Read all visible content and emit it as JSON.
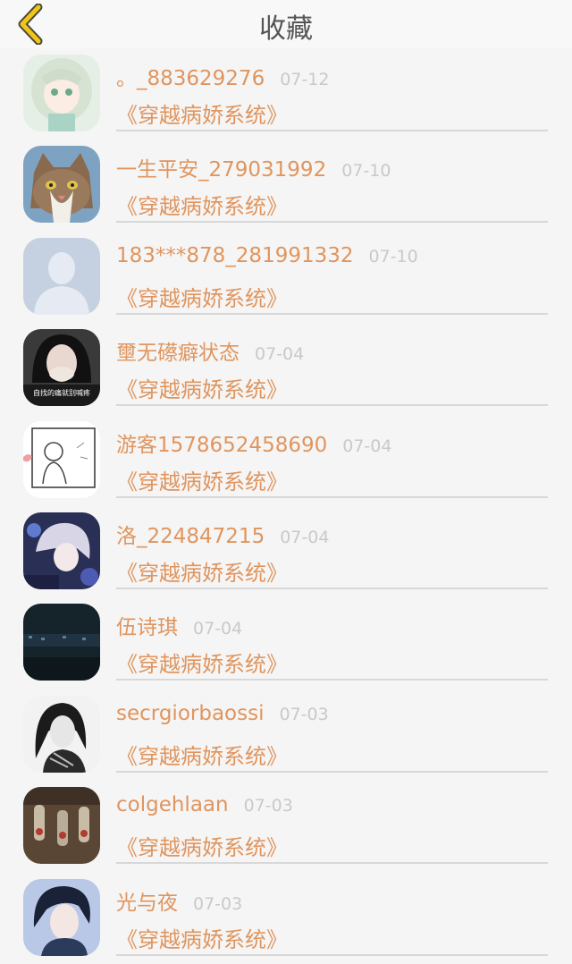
{
  "header": {
    "title": "收藏",
    "back_icon": "chevron-left-icon",
    "accent_color": "#f0c419"
  },
  "items": [
    {
      "user": "。_883629276",
      "date": "07-12",
      "book": "《穿越病娇系统》",
      "avatar": "anime-girl-avatar"
    },
    {
      "user": "一生平安_279031992",
      "date": "07-10",
      "book": "《穿越病娇系统》",
      "avatar": "cat-avatar"
    },
    {
      "user": "183***878_281991332",
      "date": "07-10",
      "book": "《穿越病娇系统》",
      "avatar": "default-person-avatar"
    },
    {
      "user": "壐无礤癖状态",
      "date": "07-04",
      "book": "《穿越病娇系统》",
      "avatar": "girl-photo-avatar"
    },
    {
      "user": "游客1578652458690",
      "date": "07-04",
      "book": "《穿越病娇系统》",
      "avatar": "sketch-avatar"
    },
    {
      "user": "洛_224847215",
      "date": "07-04",
      "book": "《穿越病娇系统》",
      "avatar": "anime-boy-avatar"
    },
    {
      "user": "伍诗琪",
      "date": "07-04",
      "book": "《穿越病娇系统》",
      "avatar": "night-city-avatar"
    },
    {
      "user": "secrgiorbaossi",
      "date": "07-03",
      "book": "《穿越病娇系统》",
      "avatar": "bw-girl-avatar"
    },
    {
      "user": "colgehlaan",
      "date": "07-03",
      "book": "《穿越病娇系统》",
      "avatar": "bottles-avatar"
    },
    {
      "user": "光与夜",
      "date": "07-03",
      "book": "《穿越病娇系统》",
      "avatar": "anime-man-avatar"
    }
  ],
  "avatar_caption": "自找的痛就别喊疼"
}
